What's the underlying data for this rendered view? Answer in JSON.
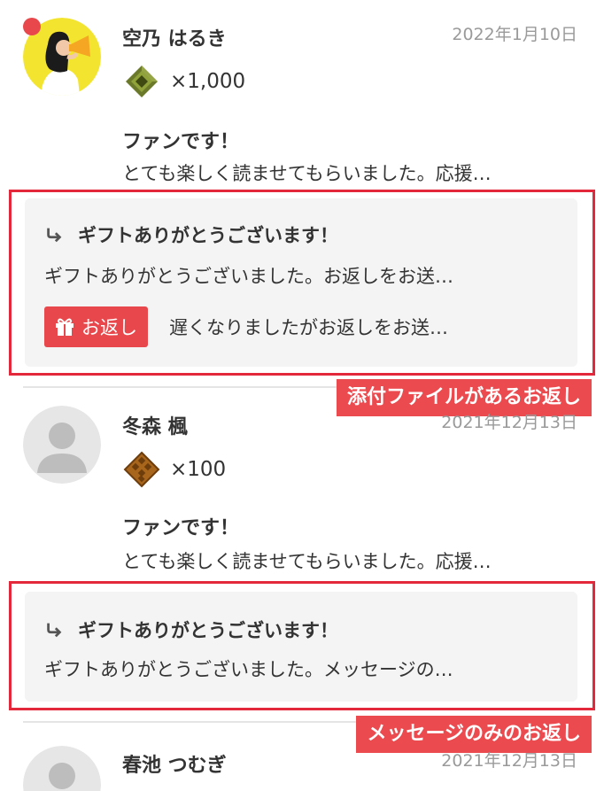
{
  "entries": [
    {
      "name": "空乃 はるき",
      "date": "2022年1月10日",
      "gift_count": "×1,000",
      "message_title": "ファンです！",
      "message_body": "とても楽しく読ませてもらいました。応援…",
      "reply": {
        "title": "ギフトありがとうございます！",
        "body": "ギフトありがとうございました。お返しをお送…",
        "return_button": "お返し",
        "return_text": "遅くなりましたがお返しをお送…"
      }
    },
    {
      "name": "冬森 楓",
      "date": "2021年12月13日",
      "gift_count": "×100",
      "message_title": "ファンです！",
      "message_body": "とても楽しく読ませてもらいました。応援…",
      "reply": {
        "title": "ギフトありがとうございます！",
        "body": "ギフトありがとうございました。メッセージの…"
      }
    },
    {
      "name": "春池 つむぎ",
      "date": "2021年12月13日"
    }
  ],
  "callouts": {
    "attachment_reply": "添付ファイルがあるお返し",
    "message_only_reply": "メッセージのみのお返し"
  },
  "colors": {
    "accent_red": "#e8484c",
    "highlight_border": "#e2283a",
    "reply_bg": "#f4f4f4"
  }
}
